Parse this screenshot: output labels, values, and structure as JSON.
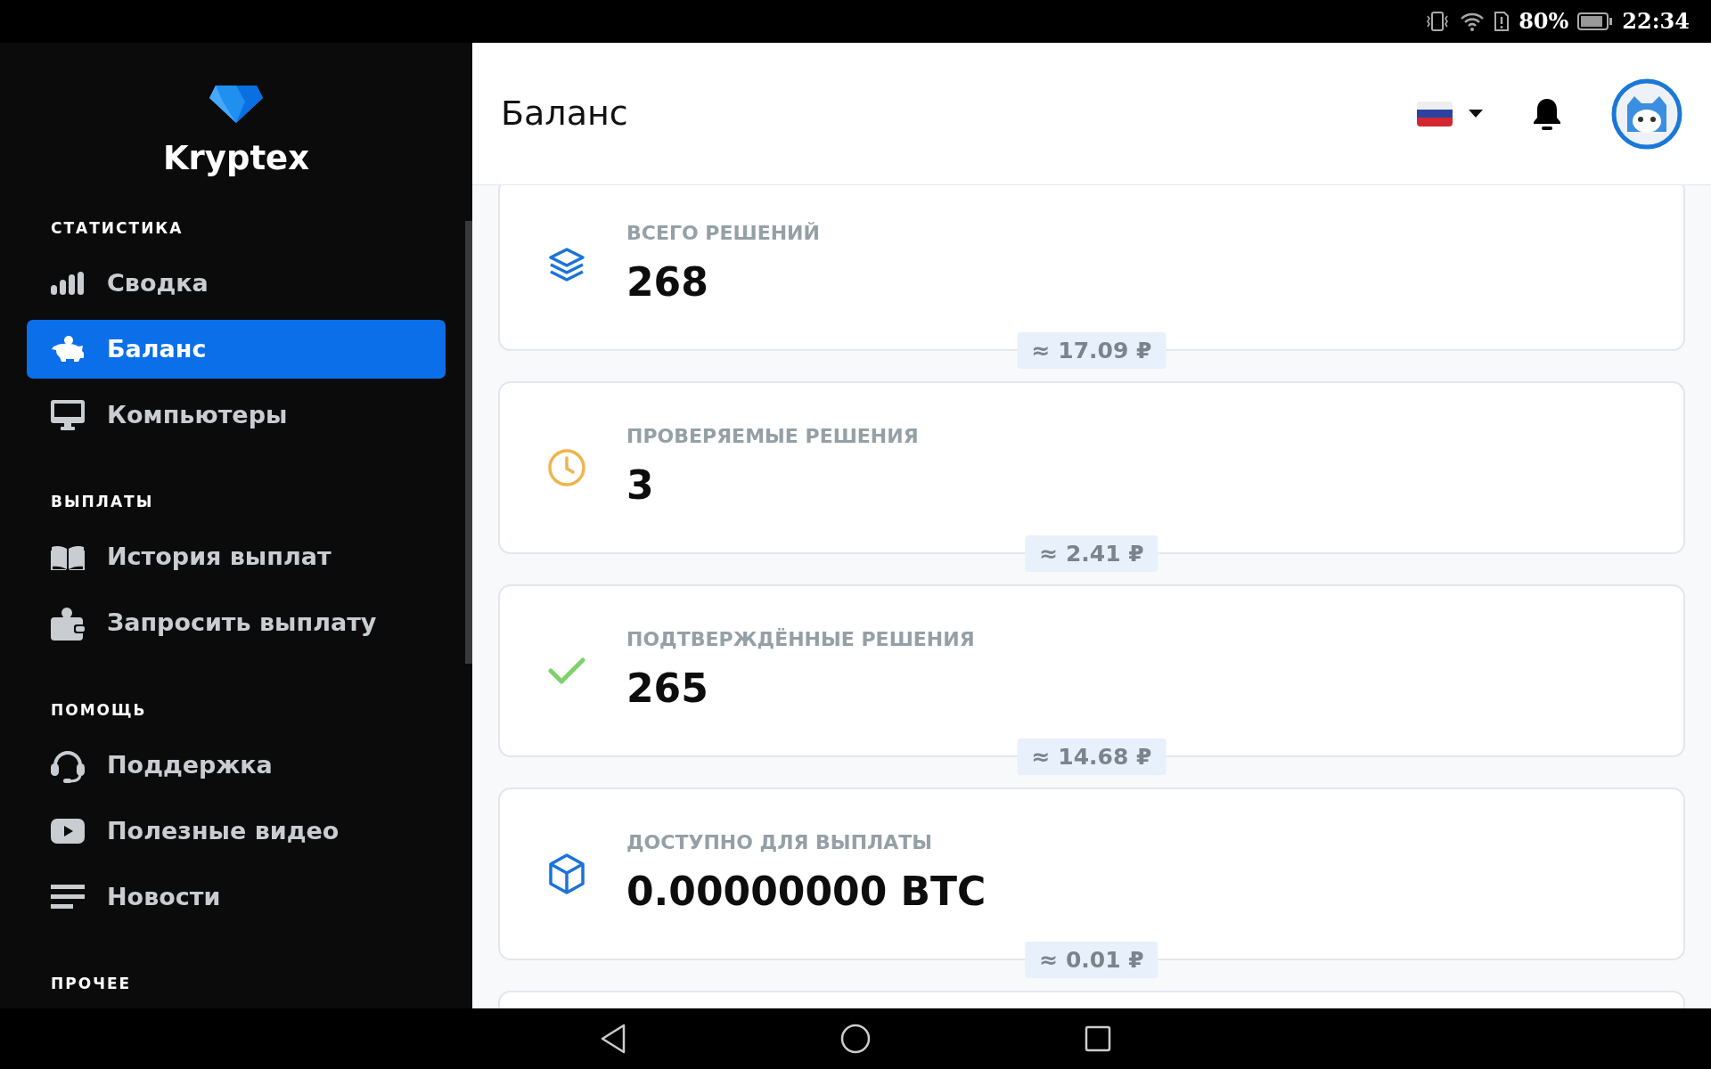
{
  "status_bar": {
    "battery": "80%",
    "time": "22:34"
  },
  "sidebar": {
    "logo": "Kryptex",
    "sections": [
      {
        "title": "СТАТИСТИКА",
        "items": [
          {
            "label": "Сводка",
            "kind": "bars",
            "selected": false
          },
          {
            "label": "Баланс",
            "kind": "piggy",
            "selected": true
          },
          {
            "label": "Компьютеры",
            "kind": "monitor",
            "selected": false
          }
        ]
      },
      {
        "title": "ВЫПЛАТЫ",
        "items": [
          {
            "label": "История выплат",
            "kind": "book",
            "selected": false
          },
          {
            "label": "Запросить выплату",
            "kind": "wallet",
            "selected": false
          }
        ]
      },
      {
        "title": "ПОМОЩЬ",
        "items": [
          {
            "label": "Поддержка",
            "kind": "headset",
            "selected": false
          },
          {
            "label": "Полезные видео",
            "kind": "video",
            "selected": false
          },
          {
            "label": "Новости",
            "kind": "lines",
            "selected": false
          }
        ]
      },
      {
        "title": "ПРОЧЕЕ"
      }
    ]
  },
  "header": {
    "title": "Баланс"
  },
  "cards": [
    {
      "kind": "layers",
      "label": "ВСЕГО РЕШЕНИЙ",
      "value": "268",
      "approx": "≈ 17.09 ₽"
    },
    {
      "kind": "clock",
      "label": "ПРОВЕРЯЕМЫЕ РЕШЕНИЯ",
      "value": "3",
      "approx": "≈ 2.41 ₽"
    },
    {
      "kind": "check",
      "label": "ПОДТВЕРЖДЁННЫЕ РЕШЕНИЯ",
      "value": "265",
      "approx": "≈ 14.68 ₽"
    },
    {
      "kind": "cube",
      "label": "ДОСТУПНО ДЛЯ ВЫПЛАТЫ",
      "value": "0.00000000 BTC",
      "approx": "≈ 0.01 ₽"
    }
  ]
}
